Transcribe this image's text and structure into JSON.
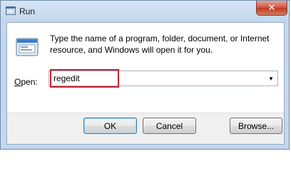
{
  "window": {
    "title": "Run",
    "close_label": "✕"
  },
  "dialog": {
    "description": "Type the name of a program, folder, document, or Internet resource, and Windows will open it for you.",
    "open_label_prefix": "",
    "open_label_underlined": "O",
    "open_label_rest": "pen:",
    "open_value": "regedit",
    "dropdown_arrow": "▼"
  },
  "buttons": {
    "ok": "OK",
    "cancel": "Cancel",
    "browse": "Browse..."
  },
  "icons": {
    "title": "run-window-icon",
    "dialog": "run-program-icon",
    "close": "close-icon",
    "dropdown": "chevron-down-icon"
  },
  "colors": {
    "highlight": "#cc1f2a",
    "close_button": "#d2533f",
    "frame": "#c3d7ee"
  }
}
